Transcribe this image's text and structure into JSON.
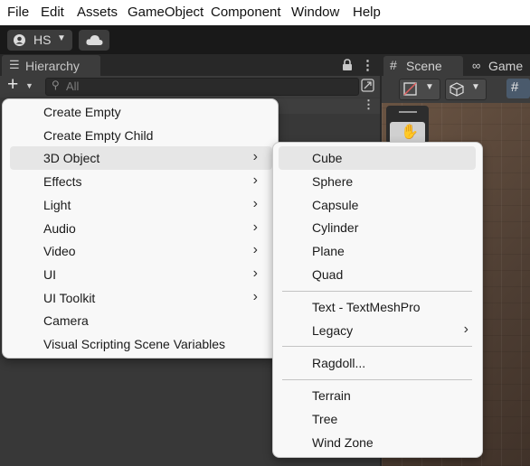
{
  "menubar": {
    "items": [
      "File",
      "Edit",
      "Assets",
      "GameObject",
      "Component",
      "Window",
      "Help"
    ]
  },
  "toolbar": {
    "account_label": "HS"
  },
  "hierarchy": {
    "tab_label": "Hierarchy",
    "search_placeholder": "All"
  },
  "scene": {
    "tab_scene": "Scene",
    "tab_game": "Game"
  },
  "create_menu": {
    "items": [
      {
        "label": "Create Empty",
        "submenu": false
      },
      {
        "label": "Create Empty Child",
        "submenu": false
      },
      {
        "label": "3D Object",
        "submenu": true,
        "highlighted": true
      },
      {
        "label": "Effects",
        "submenu": true
      },
      {
        "label": "Light",
        "submenu": true
      },
      {
        "label": "Audio",
        "submenu": true
      },
      {
        "label": "Video",
        "submenu": true
      },
      {
        "label": "UI",
        "submenu": true
      },
      {
        "label": "UI Toolkit",
        "submenu": true
      },
      {
        "label": "Camera",
        "submenu": false
      },
      {
        "label": "Visual Scripting Scene Variables",
        "submenu": false
      }
    ]
  },
  "submenu_3d": {
    "groups": [
      [
        {
          "label": "Cube",
          "highlighted": true
        },
        {
          "label": "Sphere"
        },
        {
          "label": "Capsule"
        },
        {
          "label": "Cylinder"
        },
        {
          "label": "Plane"
        },
        {
          "label": "Quad"
        }
      ],
      [
        {
          "label": "Text - TextMeshPro"
        },
        {
          "label": "Legacy",
          "submenu": true
        }
      ],
      [
        {
          "label": "Ragdoll..."
        }
      ],
      [
        {
          "label": "Terrain"
        },
        {
          "label": "Tree"
        },
        {
          "label": "Wind Zone"
        }
      ]
    ]
  },
  "colors": {
    "menu_bg": "#f8f8f8",
    "highlight": "#e6e6e6",
    "editor_dark": "#383838",
    "scene_ground": "#5a4636"
  }
}
